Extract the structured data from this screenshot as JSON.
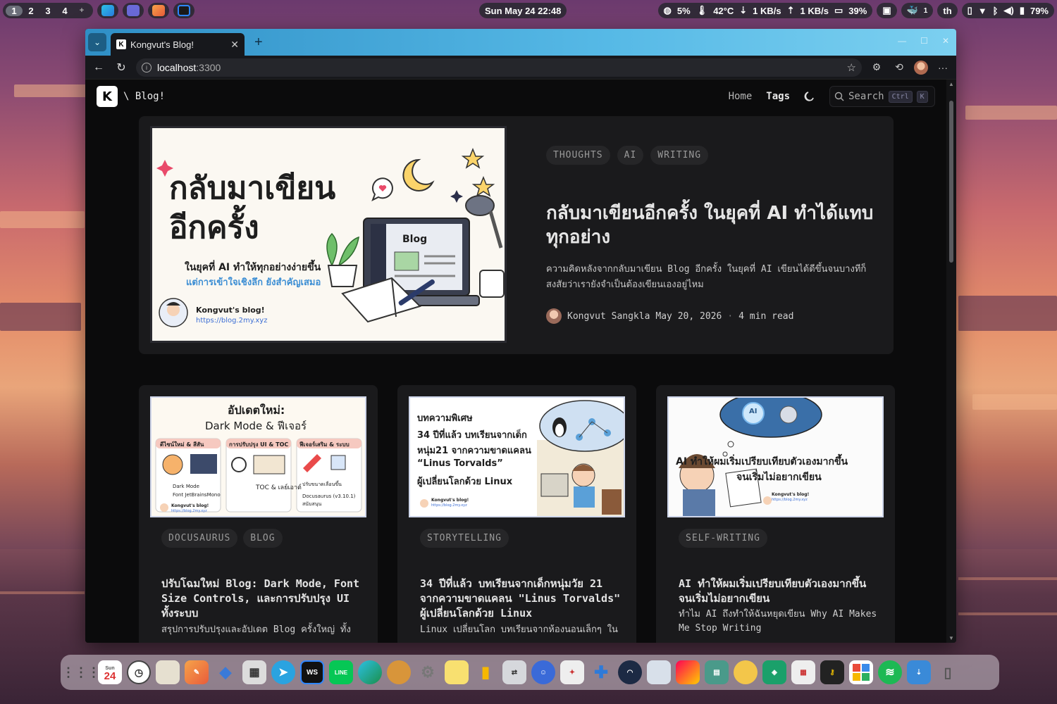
{
  "topbar": {
    "workspaces": [
      "1",
      "2",
      "3",
      "4",
      "+"
    ],
    "clock": "Sun May 24  22:48",
    "cpu": "5%",
    "temp": "42°C",
    "down": "1 KB/s",
    "up": "1 KB/s",
    "battery_mid": "39%",
    "lang": "th",
    "battery": "79%",
    "tray_badge": "1"
  },
  "browser": {
    "tab_title": "Kongvut's Blog!",
    "url_host": "localhost",
    "url_port": ":3300"
  },
  "site": {
    "logo": "K",
    "brand": "\\ Blog!",
    "nav": {
      "home": "Home",
      "tags": "Tags"
    },
    "search": {
      "label": "Search",
      "key_ctrl": "Ctrl",
      "key_k": "K"
    }
  },
  "hero": {
    "tags": [
      "THOUGHTS",
      "AI",
      "WRITING"
    ],
    "title": "กลับมาเขียนอีกครั้ง ในยุคที่ AI ทำได้แทบทุกอย่าง",
    "description": "ความคิดหลังจากกลับมาเขียน Blog อีกครั้ง ในยุคที่ AI เขียนได้ดีขึ้นจนบางทีก็สงสัยว่าเรายังจำเป็นต้องเขียนเองอยู่ไหม",
    "author": "Kongvut Sangkla",
    "date": "May 20, 2026",
    "read_time": "4 min read",
    "image": {
      "headline1": "กลับมาเขียน",
      "headline2": "อีกครั้ง",
      "sub1": "ในยุคที่ AI ทำให้ทุกอย่างง่ายขึ้น",
      "sub2": "แต่การเข้าใจเชิงลึก ยังสำคัญเสมอ",
      "screen_label": "Blog",
      "sig_name": "Kongvut's blog!",
      "sig_url": "https://blog.2my.xyz"
    }
  },
  "cards": [
    {
      "tags": [
        "DOCUSAURUS",
        "BLOG"
      ],
      "title": "ปรับโฉมใหม่ Blog: Dark Mode, Font Size Controls, และการปรับปรุง UI ทั้งระบบ",
      "desc": "สรุปการปรับปรุงและอัปเดต Blog ครั้งใหญ่ ทั้ง",
      "image": {
        "headline1": "อัปเดตใหม่:",
        "headline2": "Dark Mode & ฟีเจอร์",
        "col1": "ดีไซน์ใหม่ & สีสัน",
        "col2": "การปรับปรุง UI & TOC",
        "col3": "ฟีเจอร์เสริม & ระบบ",
        "note1": "Dark Mode",
        "note2": "Font JetBrainsMono",
        "note3": "TOC & เลย์เอาต์",
        "note4": "ปรับขนาดเลื่อนขึ้น",
        "note5": "Docusaurus (v3.10.1)",
        "note6": "สนับสนุน",
        "sig_name": "Kongvut's blog!",
        "sig_url": "https://blog.2my.xyz"
      }
    },
    {
      "tags": [
        "STORYTELLING"
      ],
      "title": "34 ปีที่แล้ว บทเรียนจากเด็กหนุ่มวัย 21 จากความขาดแคลน \"Linus Torvalds\" ผู้เปลี่ยนโลกด้วย Linux",
      "desc": "Linux เปลี่ยนโลก บทเรียนจากห้องนอนเล็กๆ ใน",
      "image": {
        "line1": "บทความพิเศษ",
        "line2": "34 ปีที่แล้ว บทเรียนจากเด็ก",
        "line3": "หนุ่ม21 จากความขาดแคลน",
        "line4": "“Linus Torvalds”",
        "line5": "ผู้เปลี่ยนโลกด้วย Linux",
        "sig_name": "Kongvut's blog!",
        "sig_url": "https://blog.2my.xyz"
      }
    },
    {
      "tags": [
        "SELF-WRITING"
      ],
      "title": "AI ทำให้ผมเริ่มเปรียบเทียบตัวเองมากขึ้น จนเริ่มไม่อยากเขียน",
      "desc": "ทำไม AI ถึงทำให้ฉันหยุดเขียน Why AI Makes Me Stop Writing",
      "image": {
        "line1": "AI ทำให้ผมเริ่มเปรียบเทียบตัวเองมากขึ้น",
        "line2": "จนเริ่มไม่อยากเขียน",
        "bubble": "AI",
        "sig_name": "Kongvut's blog!",
        "sig_url": "https://blog.2my.xyz"
      }
    }
  ],
  "dock": {
    "calendar_day": "Sun",
    "calendar_date": "24",
    "ws_label": "WS",
    "line_label": "LINE"
  }
}
